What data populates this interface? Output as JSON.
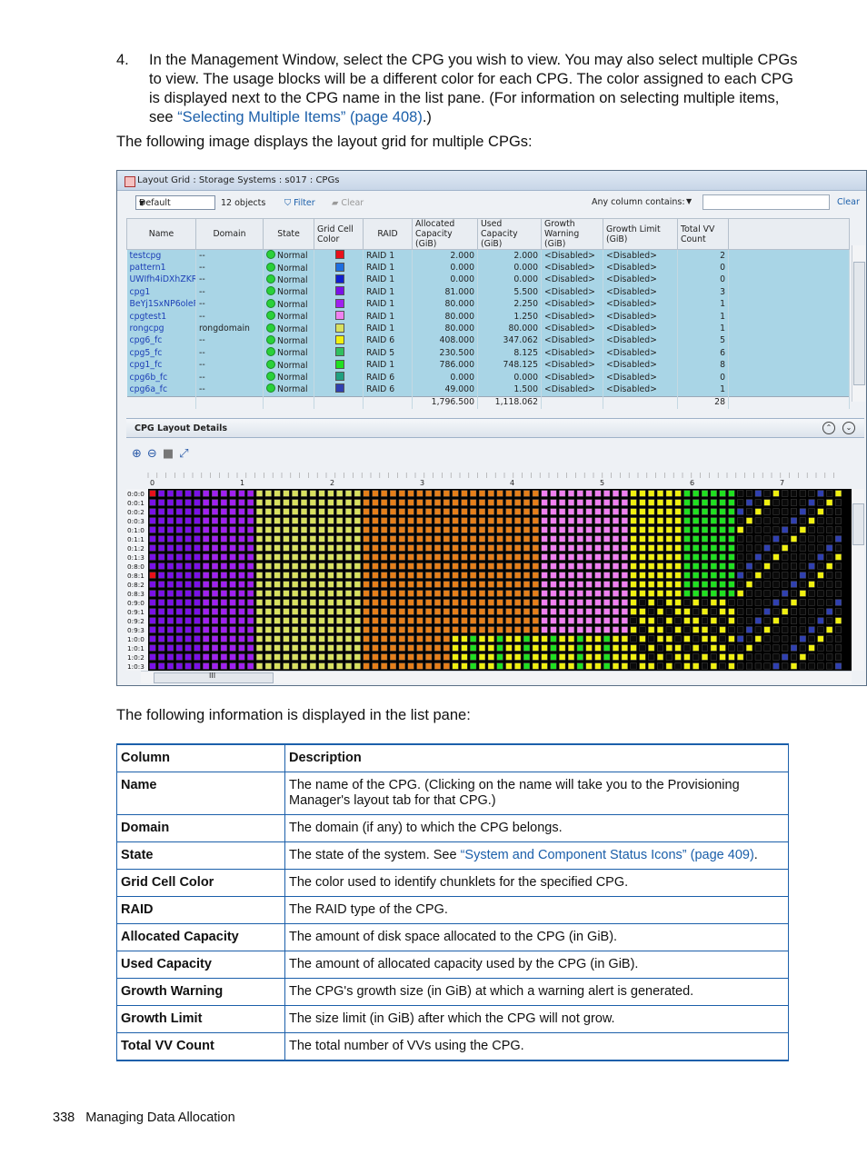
{
  "intro": {
    "step_number": "4.",
    "step_text_before": "In the Management Window, select the CPG you wish to view. You may also select multiple CPGs to view. The usage blocks will be a different color for each CPG. The color assigned to each CPG is displayed next to the CPG name in the list pane. (For information on selecting multiple items, see ",
    "step_link": "“Selecting Multiple Items” (page 408)",
    "step_text_after": ".)",
    "image_caption": "The following image displays the layout grid for multiple CPGs:"
  },
  "window": {
    "title": "Layout Grid : Storage Systems : s017 : CPGs",
    "toolbar": {
      "view_select": "Default",
      "object_count": "12 objects",
      "filter_label": "Filter",
      "clear_label": "Clear",
      "any_column_label": "Any column contains:",
      "clear_link": "Clear"
    },
    "columns": [
      "Name",
      "Domain",
      "State",
      "Grid Cell Color",
      "RAID",
      "Allocated Capacity (GiB)",
      "Used Capacity (GiB)",
      "Growth Warning (GiB)",
      "Growth Limit (GiB)",
      "Total VV Count"
    ],
    "rows": [
      {
        "name": "testcpg",
        "domain": "--",
        "state": "Normal",
        "color": "#e8101a",
        "raid": "RAID 1",
        "allocated": "2.000",
        "used": "2.000",
        "warning": "<Disabled>",
        "limit": "<Disabled>",
        "vv": "2"
      },
      {
        "name": "pattern1",
        "domain": "--",
        "state": "Normal",
        "color": "#1e6fe0",
        "raid": "RAID 1",
        "allocated": "0.000",
        "used": "0.000",
        "warning": "<Disabled>",
        "limit": "<Disabled>",
        "vv": "0"
      },
      {
        "name": "UWIfh4iDXhZKR",
        "domain": "--",
        "state": "Normal",
        "color": "#1020d0",
        "raid": "RAID 1",
        "allocated": "0.000",
        "used": "0.000",
        "warning": "<Disabled>",
        "limit": "<Disabled>",
        "vv": "0"
      },
      {
        "name": "cpg1",
        "domain": "--",
        "state": "Normal",
        "color": "#7a10e8",
        "raid": "RAID 1",
        "allocated": "81.000",
        "used": "5.500",
        "warning": "<Disabled>",
        "limit": "<Disabled>",
        "vv": "3"
      },
      {
        "name": "BeYj1SxNP6oleF",
        "domain": "--",
        "state": "Normal",
        "color": "#a020f0",
        "raid": "RAID 1",
        "allocated": "80.000",
        "used": "2.250",
        "warning": "<Disabled>",
        "limit": "<Disabled>",
        "vv": "1"
      },
      {
        "name": "cpgtest1",
        "domain": "--",
        "state": "Normal",
        "color": "#f080f0",
        "raid": "RAID 1",
        "allocated": "80.000",
        "used": "1.250",
        "warning": "<Disabled>",
        "limit": "<Disabled>",
        "vv": "1"
      },
      {
        "name": "rongcpg",
        "domain": "rongdomain",
        "state": "Normal",
        "color": "#d8e060",
        "raid": "RAID 1",
        "allocated": "80.000",
        "used": "80.000",
        "warning": "<Disabled>",
        "limit": "<Disabled>",
        "vv": "1"
      },
      {
        "name": "cpg6_fc",
        "domain": "--",
        "state": "Normal",
        "color": "#f0f010",
        "raid": "RAID 6",
        "allocated": "408.000",
        "used": "347.062",
        "warning": "<Disabled>",
        "limit": "<Disabled>",
        "vv": "5"
      },
      {
        "name": "cpg5_fc",
        "domain": "--",
        "state": "Normal",
        "color": "#30c060",
        "raid": "RAID 5",
        "allocated": "230.500",
        "used": "8.125",
        "warning": "<Disabled>",
        "limit": "<Disabled>",
        "vv": "6"
      },
      {
        "name": "cpg1_fc",
        "domain": "--",
        "state": "Normal",
        "color": "#20e020",
        "raid": "RAID 1",
        "allocated": "786.000",
        "used": "748.125",
        "warning": "<Disabled>",
        "limit": "<Disabled>",
        "vv": "8"
      },
      {
        "name": "cpg6b_fc",
        "domain": "--",
        "state": "Normal",
        "color": "#20a080",
        "raid": "RAID 6",
        "allocated": "0.000",
        "used": "0.000",
        "warning": "<Disabled>",
        "limit": "<Disabled>",
        "vv": "0"
      },
      {
        "name": "cpg6a_fc",
        "domain": "--",
        "state": "Normal",
        "color": "#3040b0",
        "raid": "RAID 6",
        "allocated": "49.000",
        "used": "1.500",
        "warning": "<Disabled>",
        "limit": "<Disabled>",
        "vv": "1"
      }
    ],
    "totals": {
      "allocated": "1,796.500",
      "used": "1,118.062",
      "vv": "28"
    },
    "details_label": "CPG Layout Details",
    "layout": {
      "col_labels": [
        "0",
        "1",
        "2",
        "3",
        "4",
        "5",
        "6",
        "7"
      ],
      "row_labels": [
        "0:0:0",
        "0:0:1",
        "0:0:2",
        "0:0:3",
        "0:1:0",
        "0:1:1",
        "0:1:2",
        "0:1:3",
        "0:8:0",
        "0:8:1",
        "0:8:2",
        "0:8:3",
        "0:9:0",
        "0:9:1",
        "0:9:2",
        "0:9:3",
        "1:0:0",
        "1:0:1",
        "1:0:2",
        "1:0:3"
      ],
      "free_color": "#0a0a0a",
      "grid_line_color": "#555555"
    },
    "hscroll_mark": "III"
  },
  "list_caption": "The following information is displayed in the list pane:",
  "desc_table": {
    "headers": [
      "Column",
      "Description"
    ],
    "rows": [
      {
        "col": "Name",
        "desc": "The name of the CPG. (Clicking on the name will take you to the Provisioning Manager's layout tab for that CPG.)"
      },
      {
        "col": "Domain",
        "desc": "The domain (if any) to which the CPG belongs."
      },
      {
        "col": "State",
        "desc_before": "The state of the system. See ",
        "desc_link": "“System and Component Status Icons” (page 409)",
        "desc_after": "."
      },
      {
        "col": "Grid Cell Color",
        "desc": "The color used to identify chunklets for the specified CPG."
      },
      {
        "col": "RAID",
        "desc": "The RAID type of the CPG."
      },
      {
        "col": "Allocated Capacity",
        "desc": "The amount of disk space allocated to the CPG (in GiB)."
      },
      {
        "col": "Used Capacity",
        "desc": "The amount of allocated capacity used by the CPG (in GiB)."
      },
      {
        "col": "Growth Warning",
        "desc": "The CPG's growth size (in GiB) at which a warning alert is generated."
      },
      {
        "col": "Growth Limit",
        "desc": "The size limit (in GiB) after which the CPG will not grow."
      },
      {
        "col": "Total VV Count",
        "desc": "The total number of VVs using the CPG."
      }
    ]
  },
  "footer": {
    "page_number": "338",
    "section": "Managing Data Allocation"
  }
}
